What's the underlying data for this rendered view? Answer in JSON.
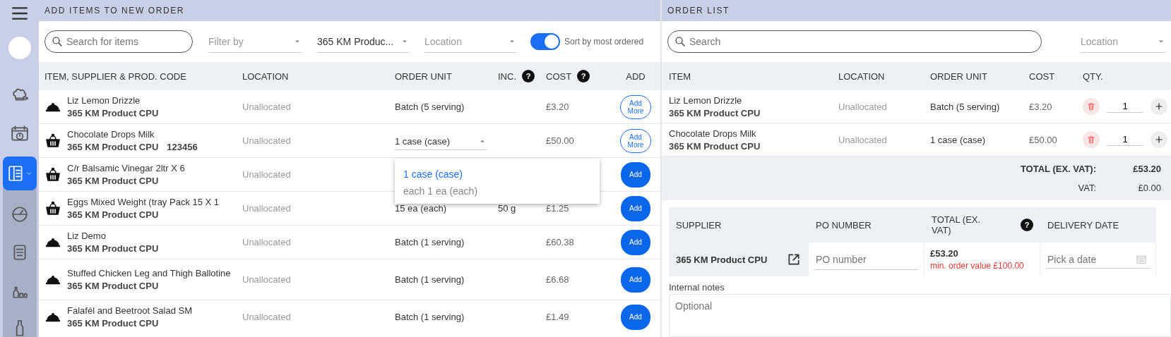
{
  "sidebar": {
    "items": [
      {
        "kind": "chef",
        "selected": false
      },
      {
        "kind": "calendar",
        "selected": false
      },
      {
        "kind": "catalog",
        "selected": true
      },
      {
        "kind": "gauge",
        "selected": false
      },
      {
        "kind": "receipt",
        "selected": false
      },
      {
        "kind": "bottles",
        "selected": false
      },
      {
        "kind": "bottle",
        "selected": false
      }
    ]
  },
  "add_panel": {
    "title": "ADD ITEMS TO NEW ORDER",
    "search": {
      "placeholder": "Search for items"
    },
    "filters": [
      {
        "placeholder": "Filter by"
      },
      {
        "value": "365 KM Produc..."
      },
      {
        "placeholder": "Location"
      }
    ],
    "sort_toggle": {
      "label": "Sort by most ordered",
      "on": true
    },
    "columns": [
      {
        "label": "ITEM, SUPPLIER & PROD. CODE"
      },
      {
        "label": "LOCATION"
      },
      {
        "label": "ORDER UNIT"
      },
      {
        "label": "INC.",
        "help": "?"
      },
      {
        "label": "COST",
        "help": "?"
      },
      {
        "label": "ADD"
      }
    ],
    "rows": [
      {
        "kind": "dish",
        "name": "Liz Lemon Drizzle",
        "supplier": "365 KM Product CPU",
        "location": "Unallocated",
        "unit": "Batch (5 serving)",
        "cost": "£3.20",
        "button": {
          "kind": "add_more",
          "label": "Add More"
        },
        "unit_menu_open": false
      },
      {
        "kind": "basket",
        "name": "Chocolate Drops Milk",
        "supplier": "365 KM Product CPU",
        "code": "123456",
        "location": "Unallocated",
        "unit": "1 case (case)",
        "cost": "£50.00",
        "button": {
          "kind": "add_more",
          "label": "Add More"
        },
        "unit_menu_open": true,
        "unit_menu": [
          {
            "label": "1 case (case)",
            "selected": true
          },
          {
            "label": "each 1 ea (each)",
            "selected": false
          }
        ]
      },
      {
        "kind": "basket",
        "name": "C/r Balsamic Vinegar 2ltr X 6",
        "supplier": "365 KM Product CPU",
        "location": "Unallocated",
        "button": {
          "kind": "add",
          "label": "Add"
        },
        "unit_menu_open": false
      },
      {
        "kind": "basket",
        "name": "Eggs Mixed Weight (tray Pack 15 X 1",
        "supplier": "365 KM Product CPU",
        "location": "Unallocated",
        "unit": "15 ea (each)",
        "inc": "50 g",
        "cost": "£1.25",
        "button": {
          "kind": "add",
          "label": "Add"
        },
        "unit_menu_open": false
      },
      {
        "kind": "dish",
        "name": "Liz Demo",
        "supplier": "365 KM Product CPU",
        "location": "Unallocated",
        "unit": "Batch (1 serving)",
        "cost": "£60.38",
        "button": {
          "kind": "add",
          "label": "Add"
        },
        "unit_menu_open": false
      },
      {
        "kind": "dish",
        "name": "Stuffed Chicken Leg and Thigh Ballotine",
        "supplier": "365 KM Product CPU",
        "location": "Unallocated",
        "unit": "Batch (1 serving)",
        "cost": "£6.68",
        "button": {
          "kind": "add",
          "label": "Add"
        },
        "unit_menu_open": false
      },
      {
        "kind": "dish",
        "name": "Falafél and Beetroot Salad SM",
        "supplier": "365 KM Product CPU",
        "location": "Unallocated",
        "unit": "Batch (1 serving)",
        "cost": "£1.49",
        "button": {
          "kind": "add",
          "label": "Add"
        },
        "unit_menu_open": false
      }
    ]
  },
  "order_panel": {
    "title": "ORDER LIST",
    "search": {
      "placeholder": "Search"
    },
    "location_filter": {
      "placeholder": "Location"
    },
    "columns": [
      {
        "label": "ITEM"
      },
      {
        "label": "LOCATION"
      },
      {
        "label": "ORDER UNIT"
      },
      {
        "label": "COST"
      },
      {
        "label": "QTY."
      }
    ],
    "rows": [
      {
        "name": "Liz Lemon Drizzle",
        "supplier": "365 KM Product CPU",
        "location": "Unallocated",
        "unit": "Batch (5 serving)",
        "cost": "£3.20",
        "qty": "1"
      },
      {
        "name": "Chocolate Drops Milk",
        "supplier": "365 KM Product CPU",
        "location": "Unallocated",
        "unit": "1 case (case)",
        "cost": "£50.00",
        "qty": "1"
      }
    ],
    "totals": [
      {
        "label": "TOTAL (EX. VAT):",
        "value": "£53.20",
        "kind": "bold"
      },
      {
        "label": "VAT:",
        "value": "£0.00",
        "kind": "plain"
      }
    ],
    "supplier_table": {
      "columns": [
        {
          "label": "SUPPLIER"
        },
        {
          "label": "PO NUMBER"
        },
        {
          "label": "TOTAL (EX. VAT)",
          "help": "?"
        },
        {
          "label": "DELIVERY DATE"
        }
      ],
      "row": {
        "supplier": "365 KM Product CPU",
        "po_placeholder": "PO number",
        "total": "£53.20",
        "warning": "min. order value £100.00",
        "date_placeholder": "Pick a date"
      }
    },
    "notes": {
      "label": "Internal notes",
      "placeholder": "Optional"
    }
  }
}
